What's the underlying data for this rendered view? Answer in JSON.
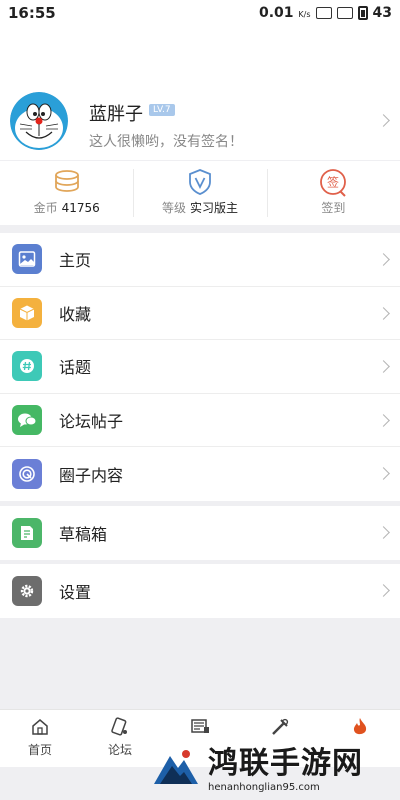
{
  "status_bar": {
    "time": "16:55",
    "speed": "0.01",
    "speed_unit": "K/s",
    "battery": "43"
  },
  "profile": {
    "username": "蓝胖子",
    "level": "LV.7",
    "signature": "这人很懒哟，没有签名！"
  },
  "stats": [
    {
      "label": "金币",
      "value": "41756",
      "icon": "coins-icon"
    },
    {
      "label": "等级",
      "value": "实习版主",
      "icon": "shield-v-icon"
    },
    {
      "label": "签到",
      "value": "",
      "icon": "sign-in-icon",
      "icon_text": "签"
    }
  ],
  "menu": {
    "group1": [
      {
        "label": "主页",
        "icon": "picture-icon",
        "color": "#5b7fd0"
      },
      {
        "label": "收藏",
        "icon": "box-icon",
        "color": "#f4b13e"
      },
      {
        "label": "话题",
        "icon": "hash-icon",
        "color": "#3ec9b7"
      },
      {
        "label": "论坛帖子",
        "icon": "chat-icon",
        "color": "#45b864"
      },
      {
        "label": "圈子内容",
        "icon": "circle-icon",
        "color": "#6b7fd6"
      }
    ],
    "group2": [
      {
        "label": "草稿箱",
        "icon": "draft-icon",
        "color": "#4cb669"
      }
    ],
    "group3": [
      {
        "label": "设置",
        "icon": "gear-icon",
        "color": "#6d6d6d"
      }
    ]
  },
  "tabs": [
    {
      "label": "首页",
      "icon": "home-icon"
    },
    {
      "label": "论坛",
      "icon": "forum-icon"
    },
    {
      "label": "",
      "icon": "news-icon"
    },
    {
      "label": "",
      "icon": "tools-icon"
    },
    {
      "label": "",
      "icon": "hot-icon"
    }
  ],
  "watermark": {
    "title": "鸿联手游网",
    "url": "henanhonglian95.com"
  }
}
